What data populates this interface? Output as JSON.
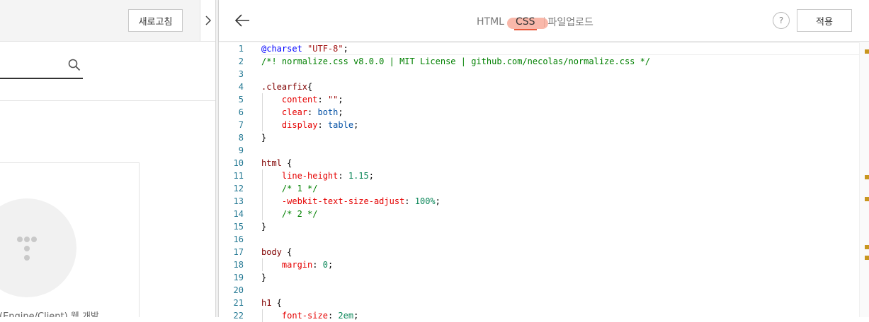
{
  "left_pane": {
    "refresh_label": "새로고침",
    "search_placeholder": "",
    "card_caption": "(Engine/Client) 웹 개발"
  },
  "right_pane": {
    "tabs": [
      {
        "label": "HTML",
        "active": false
      },
      {
        "label": "CSS",
        "active": true
      },
      {
        "label": "파일업로드",
        "active": false
      }
    ],
    "help_label": "?",
    "apply_label": "적용"
  },
  "editor": {
    "current_line": 1,
    "lines": [
      {
        "n": "1",
        "text": "@charset \"UTF-8\";"
      },
      {
        "n": "2",
        "text": "/*! normalize.css v8.0.0 | MIT License | github.com/necolas/normalize.css */"
      },
      {
        "n": "3",
        "text": ""
      },
      {
        "n": "4",
        "text": ".clearfix{"
      },
      {
        "n": "5",
        "text": "    content: \"\";"
      },
      {
        "n": "6",
        "text": "    clear: both;"
      },
      {
        "n": "7",
        "text": "    display: table;"
      },
      {
        "n": "8",
        "text": "}"
      },
      {
        "n": "9",
        "text": ""
      },
      {
        "n": "10",
        "text": "html {"
      },
      {
        "n": "11",
        "text": "    line-height: 1.15;"
      },
      {
        "n": "12",
        "text": "    /* 1 */"
      },
      {
        "n": "13",
        "text": "    -webkit-text-size-adjust: 100%;"
      },
      {
        "n": "14",
        "text": "    /* 2 */"
      },
      {
        "n": "15",
        "text": "}"
      },
      {
        "n": "16",
        "text": ""
      },
      {
        "n": "17",
        "text": "body {"
      },
      {
        "n": "18",
        "text": "    margin: 0;"
      },
      {
        "n": "19",
        "text": "}"
      },
      {
        "n": "20",
        "text": ""
      },
      {
        "n": "21",
        "text": "h1 {"
      },
      {
        "n": "22",
        "text": "    font-size: 2em;"
      }
    ],
    "marker_color": "#c8961e"
  },
  "colors": {
    "accent": "#e85a3c",
    "tab_highlight": "#f7a08e"
  }
}
